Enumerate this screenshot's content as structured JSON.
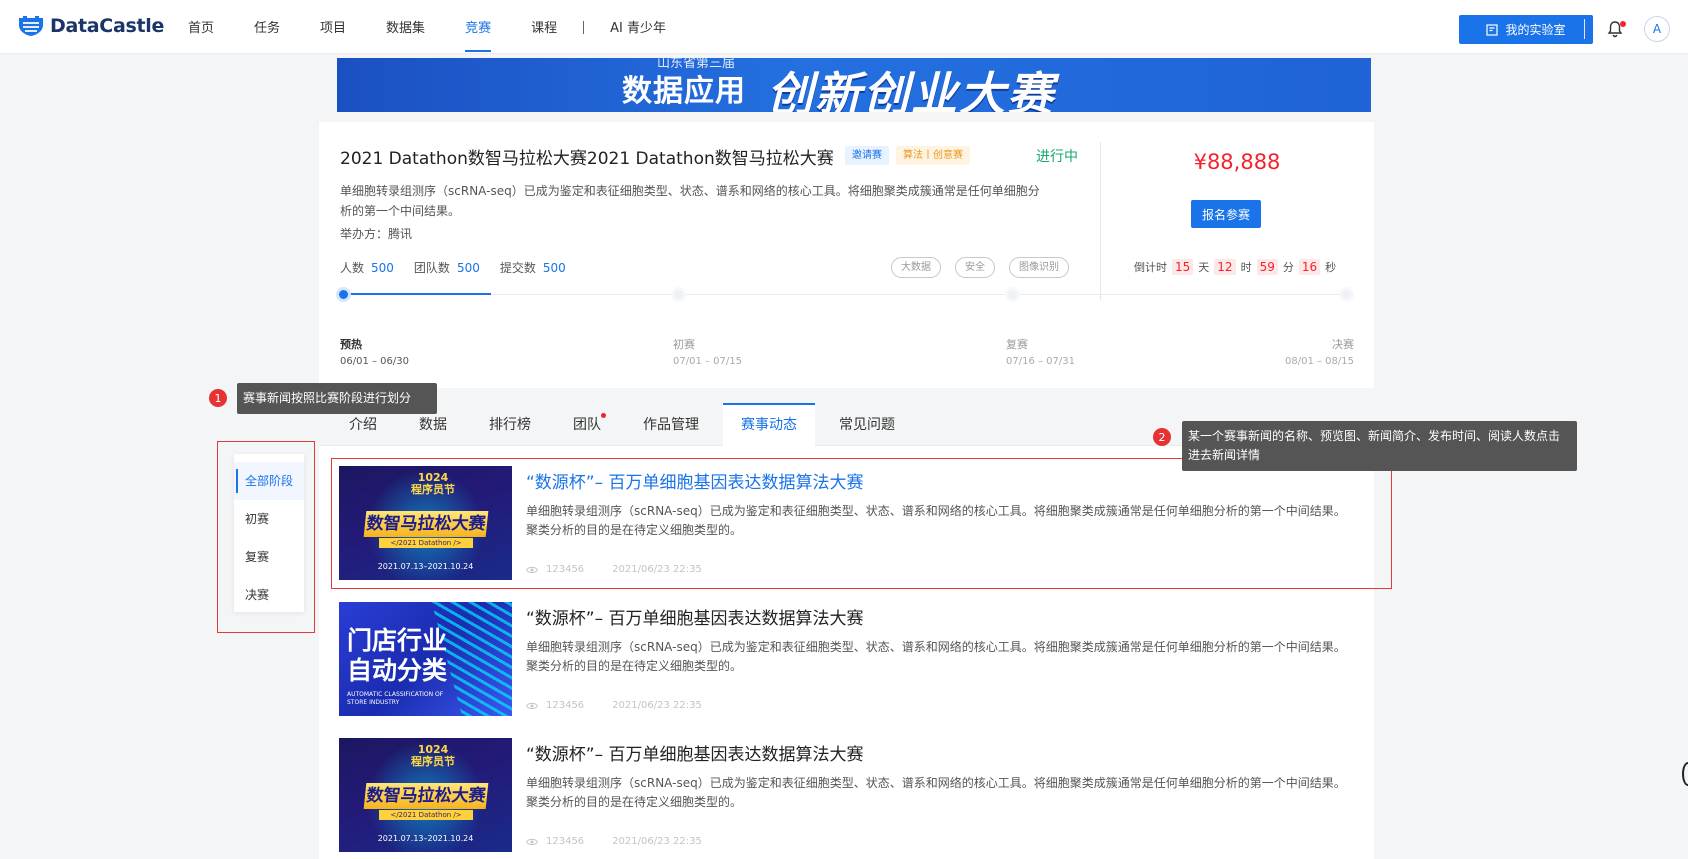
{
  "header": {
    "logo": "DataCastle",
    "nav": [
      "首页",
      "任务",
      "项目",
      "数据集",
      "竞赛",
      "课程"
    ],
    "nav_active_index": 4,
    "nav_extra": "AI 青少年",
    "lab_button": "我的实验室",
    "avatar": "A"
  },
  "banner": {
    "subtitle": "山东省第三届",
    "title_a": "数据应用",
    "title_b": "创新创业大赛"
  },
  "competition": {
    "title": "2021 Datathon数智马拉松大赛2021 Datathon数智马拉松大赛",
    "tag_invite": "邀请赛",
    "tag_type": "算法丨创意赛",
    "status": "进行中",
    "description": "单细胞转录组测序（scRNA-seq）已成为鉴定和表征细胞类型、状态、谱系和网络的核心工具。将细胞聚类成簇通常是任何单细胞分析的第一个中间结果。",
    "host": "举办方：腾讯",
    "stats": [
      {
        "label": "人数",
        "value": "500"
      },
      {
        "label": "团队数",
        "value": "500"
      },
      {
        "label": "提交数",
        "value": "500"
      }
    ],
    "chips": [
      "大数据",
      "安全",
      "图像识别"
    ],
    "prize": "¥88,888",
    "signup": "报名参赛",
    "countdown": {
      "label": "倒计时",
      "days": "15",
      "days_unit": "天",
      "hours": "12",
      "hours_unit": "时",
      "minutes": "59",
      "minutes_unit": "分",
      "seconds": "16",
      "seconds_unit": "秒"
    },
    "progress": 0.148,
    "stages": [
      {
        "name": "预热",
        "date": "06/01 – 06/30"
      },
      {
        "name": "初赛",
        "date": "07/01 – 07/15"
      },
      {
        "name": "复赛",
        "date": "07/16 – 07/31"
      },
      {
        "name": "决赛",
        "date": "08/01 – 08/15"
      }
    ]
  },
  "tabs": [
    "介绍",
    "数据",
    "排行榜",
    "团队",
    "作品管理",
    "赛事动态",
    "常见问题"
  ],
  "tab_active_index": 5,
  "filters": [
    "全部阶段",
    "初赛",
    "复赛",
    "决赛"
  ],
  "news": [
    {
      "title": "“数源杯”– 百万单细胞基因表达数据算法大赛",
      "desc": "单细胞转录组测序（scRNA-seq）已成为鉴定和表征细胞类型、状态、谱系和网络的核心工具。将细胞聚类成簇通常是任何单细胞分析的第一个中间结果。聚类分析的目的是在待定义细胞类型的。",
      "views": "123456",
      "time": "2021/06/23  22:35",
      "thumb": {
        "badge_a": "1024",
        "badge_b": "程序员节",
        "title": "数智马拉松大赛",
        "bar": "</2021 Datathon />",
        "date": "2021.07.13–2021.10.24"
      }
    },
    {
      "title": "“数源杯”– 百万单细胞基因表达数据算法大赛",
      "desc": "单细胞转录组测序（scRNA-seq）已成为鉴定和表征细胞类型、状态、谱系和网络的核心工具。将细胞聚类成簇通常是任何单细胞分析的第一个中间结果。聚类分析的目的是在待定义细胞类型的。",
      "views": "123456",
      "time": "2021/06/23  22:35",
      "thumb": {
        "line1": "门店行业",
        "line2": "自动分类",
        "small1": "AUTOMATIC CLASSIFICATION OF",
        "small2": "STORE INDUSTRY"
      }
    },
    {
      "title": "“数源杯”– 百万单细胞基因表达数据算法大赛",
      "desc": "单细胞转录组测序（scRNA-seq）已成为鉴定和表征细胞类型、状态、谱系和网络的核心工具。将细胞聚类成簇通常是任何单细胞分析的第一个中间结果。聚类分析的目的是在待定义细胞类型的。",
      "views": "123456",
      "time": "2021/06/23  22:35",
      "thumb": {
        "badge_a": "1024",
        "badge_b": "程序员节",
        "title": "数智马拉松大赛",
        "bar": "</2021 Datathon />",
        "date": "2021.07.13–2021.10.24"
      }
    }
  ],
  "annotations": [
    {
      "num": "1",
      "text": "赛事新闻按照比赛阶段进行划分"
    },
    {
      "num": "2",
      "text": "某一个赛事新闻的名称、预览图、新闻简介、发布时间、阅读人数点击进去新闻详情"
    }
  ],
  "colors": {
    "primary": "#1a73e8",
    "danger": "#f5222d",
    "success": "#17a86b",
    "annotation": "#e23a3a"
  }
}
